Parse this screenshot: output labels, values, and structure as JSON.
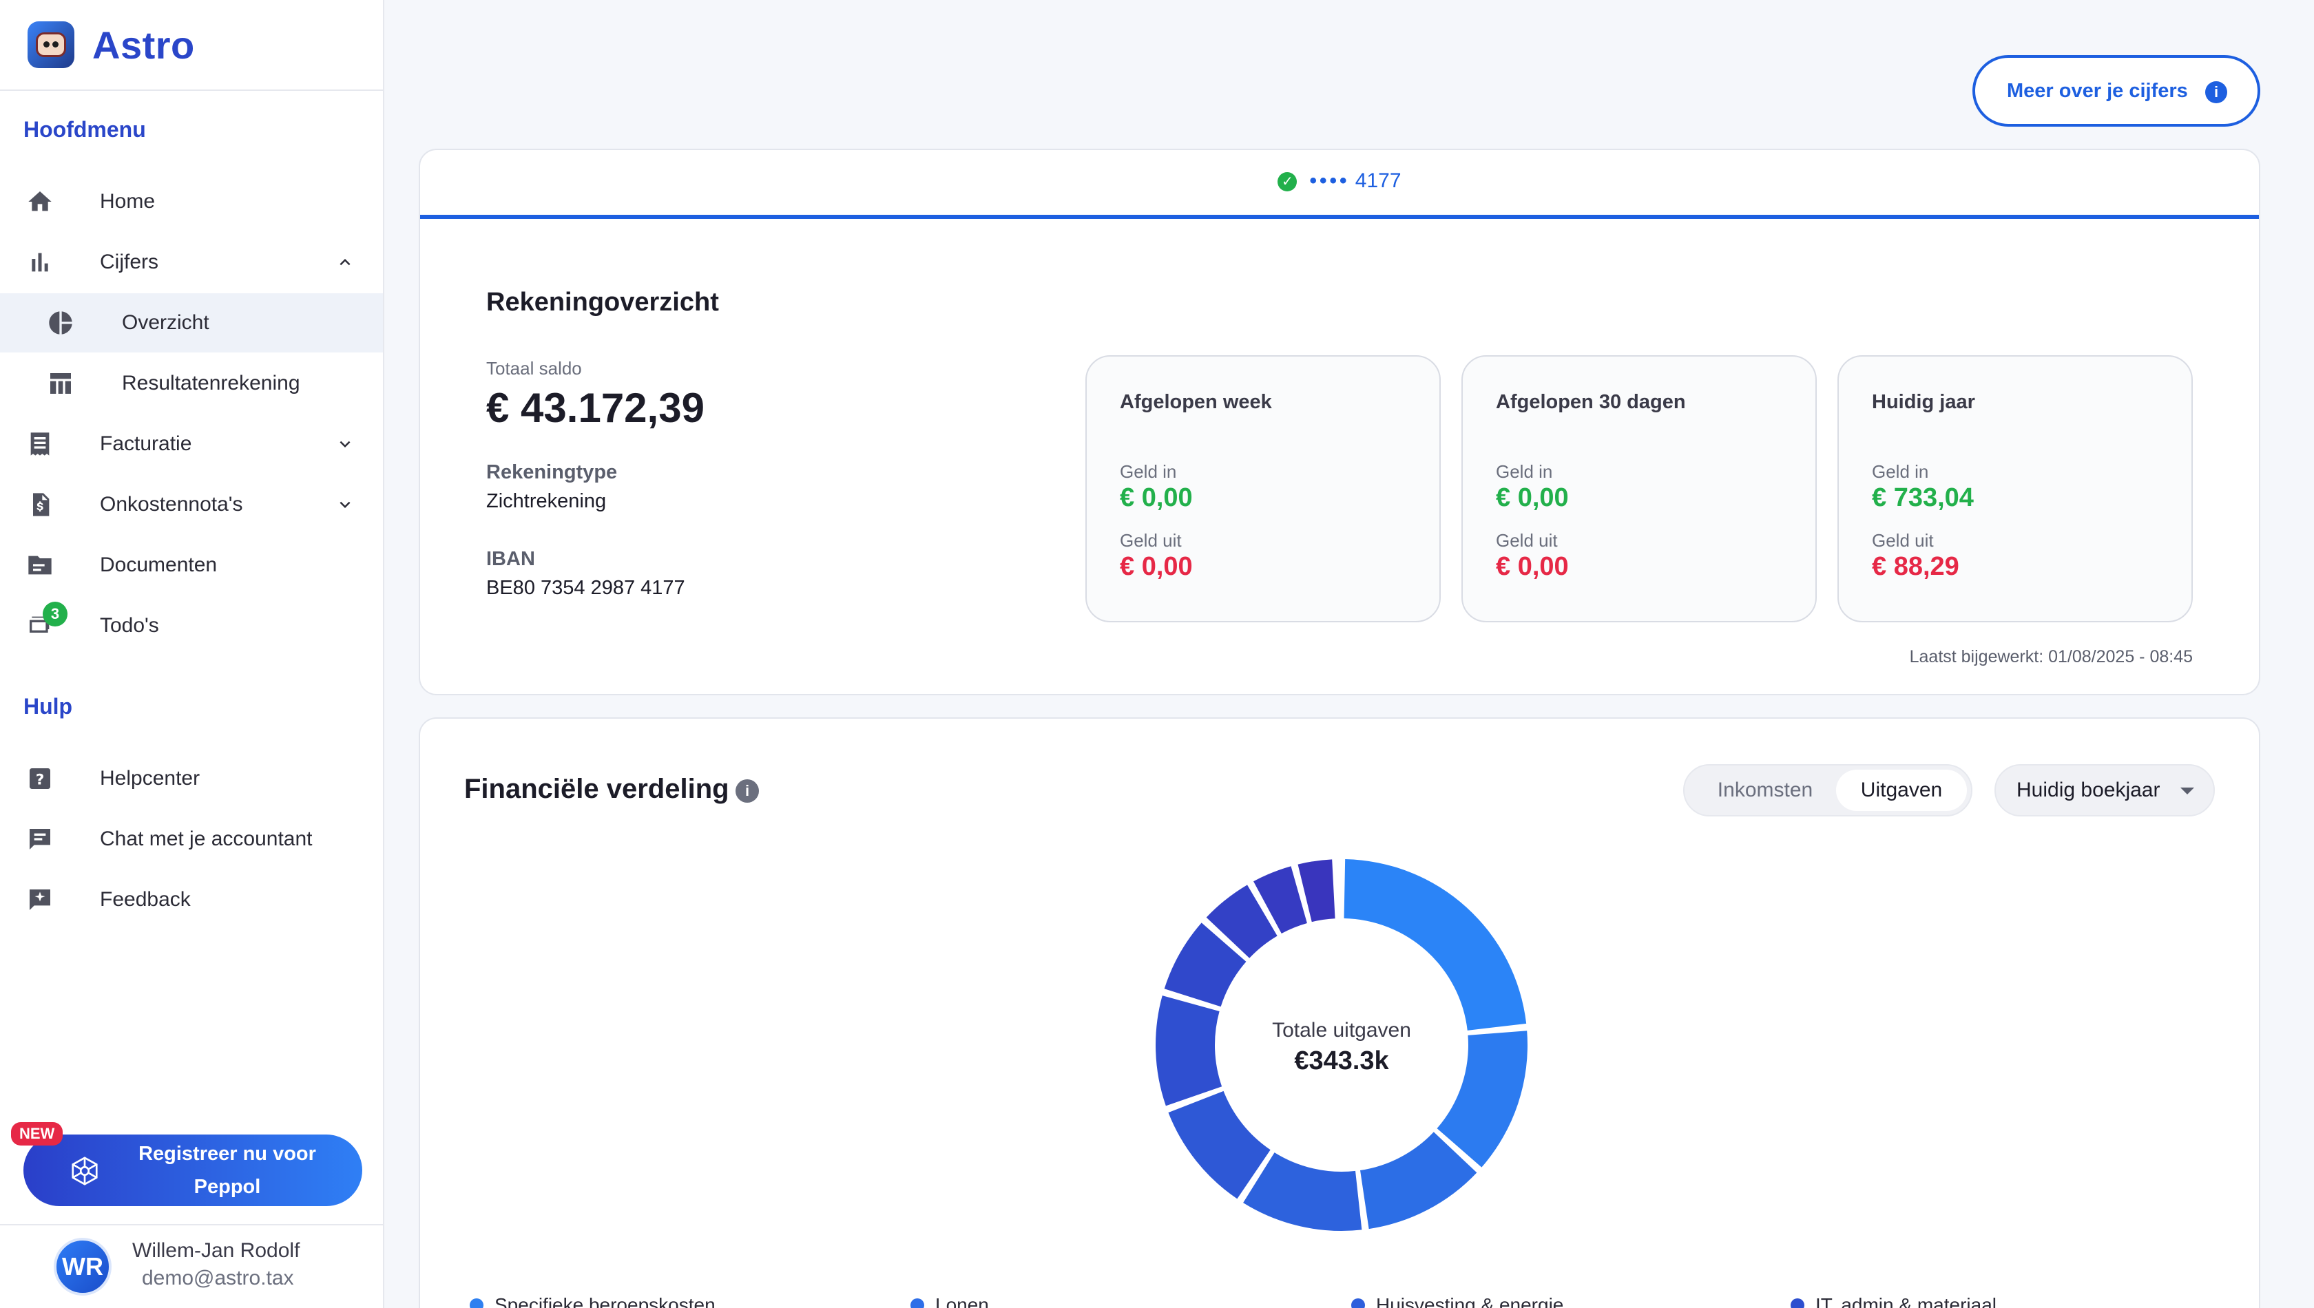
{
  "app": {
    "name": "Astro"
  },
  "sidebar": {
    "main_title": "Hoofdmenu",
    "items": [
      {
        "label": "Home",
        "icon": "home-icon"
      },
      {
        "label": "Cijfers",
        "icon": "bar-chart-icon",
        "expanded": true
      },
      {
        "label": "Overzicht",
        "icon": "pie-chart-icon",
        "active": true
      },
      {
        "label": "Resultatenrekening",
        "icon": "table-icon"
      },
      {
        "label": "Facturatie",
        "icon": "receipt-icon"
      },
      {
        "label": "Onkostennota's",
        "icon": "expense-file-icon"
      },
      {
        "label": "Documenten",
        "icon": "folder-icon"
      },
      {
        "label": "Todo's",
        "icon": "todo-icon",
        "badge": "3"
      }
    ],
    "help_title": "Hulp",
    "help_items": [
      {
        "label": "Helpcenter",
        "icon": "help-icon"
      },
      {
        "label": "Chat met je accountant",
        "icon": "chat-icon"
      },
      {
        "label": "Feedback",
        "icon": "feedback-icon"
      }
    ],
    "peppol": {
      "badge": "NEW",
      "label": "Registreer nu voor Peppol"
    },
    "user": {
      "initials": "WR",
      "name": "Willem-Jan Rodolf",
      "email": "demo@astro.tax"
    }
  },
  "header": {
    "more_button": "Meer over je cijfers"
  },
  "account": {
    "tab_dots": "••••",
    "tab_number": "4177",
    "title": "Rekeningoverzicht",
    "total_label": "Totaal saldo",
    "total_value": "€ 43.172,39",
    "type_label": "Rekeningtype",
    "type_value": "Zichtrekening",
    "iban_label": "IBAN",
    "iban_value": "BE80 7354 2987 4177",
    "periods": [
      {
        "title": "Afgelopen week",
        "in_label": "Geld in",
        "in_value": "€ 0,00",
        "out_label": "Geld uit",
        "out_value": "€ 0,00"
      },
      {
        "title": "Afgelopen 30 dagen",
        "in_label": "Geld in",
        "in_value": "€ 0,00",
        "out_label": "Geld uit",
        "out_value": "€ 0,00"
      },
      {
        "title": "Huidig jaar",
        "in_label": "Geld in",
        "in_value": "€ 733,04",
        "out_label": "Geld uit",
        "out_value": "€ 88,29"
      }
    ],
    "updated": "Laatst bijgewerkt: 01/08/2025 - 08:45"
  },
  "financial": {
    "title": "Financiële verdeling",
    "toggle": [
      {
        "label": "Inkomsten",
        "active": false
      },
      {
        "label": "Uitgaven",
        "active": true
      }
    ],
    "period_select": "Huidig boekjaar",
    "center_label": "Totale uitgaven",
    "center_value": "€343.3k",
    "legend": [
      {
        "label": "Specifieke beroepskosten",
        "color": "#2f80f0"
      },
      {
        "label": "Lonen",
        "color": "#2f6fe8"
      },
      {
        "label": "Huisvesting & energie",
        "color": "#2e5fdc"
      },
      {
        "label": "IT, admin & materiaal",
        "color": "#2d4fcf"
      }
    ],
    "segments": [
      {
        "share": 0.23,
        "color": "#2b84f7"
      },
      {
        "share": 0.13,
        "color": "#2c7bf0"
      },
      {
        "share": 0.11,
        "color": "#2c6ee6"
      },
      {
        "share": 0.11,
        "color": "#2d62dd"
      },
      {
        "share": 0.1,
        "color": "#2e58d6"
      },
      {
        "share": 0.1,
        "color": "#2f4fd0"
      },
      {
        "share": 0.07,
        "color": "#3048cb"
      },
      {
        "share": 0.05,
        "color": "#3341c6"
      },
      {
        "share": 0.04,
        "color": "#363bc2"
      },
      {
        "share": 0.035,
        "color": "#3935bd"
      },
      {
        "share": 0.005,
        "color": "#3c31b8"
      }
    ]
  },
  "colors": {
    "accent": "#1d5fe0",
    "brand": "#2a46c9",
    "positive": "#22b04b",
    "negative": "#e62846"
  }
}
